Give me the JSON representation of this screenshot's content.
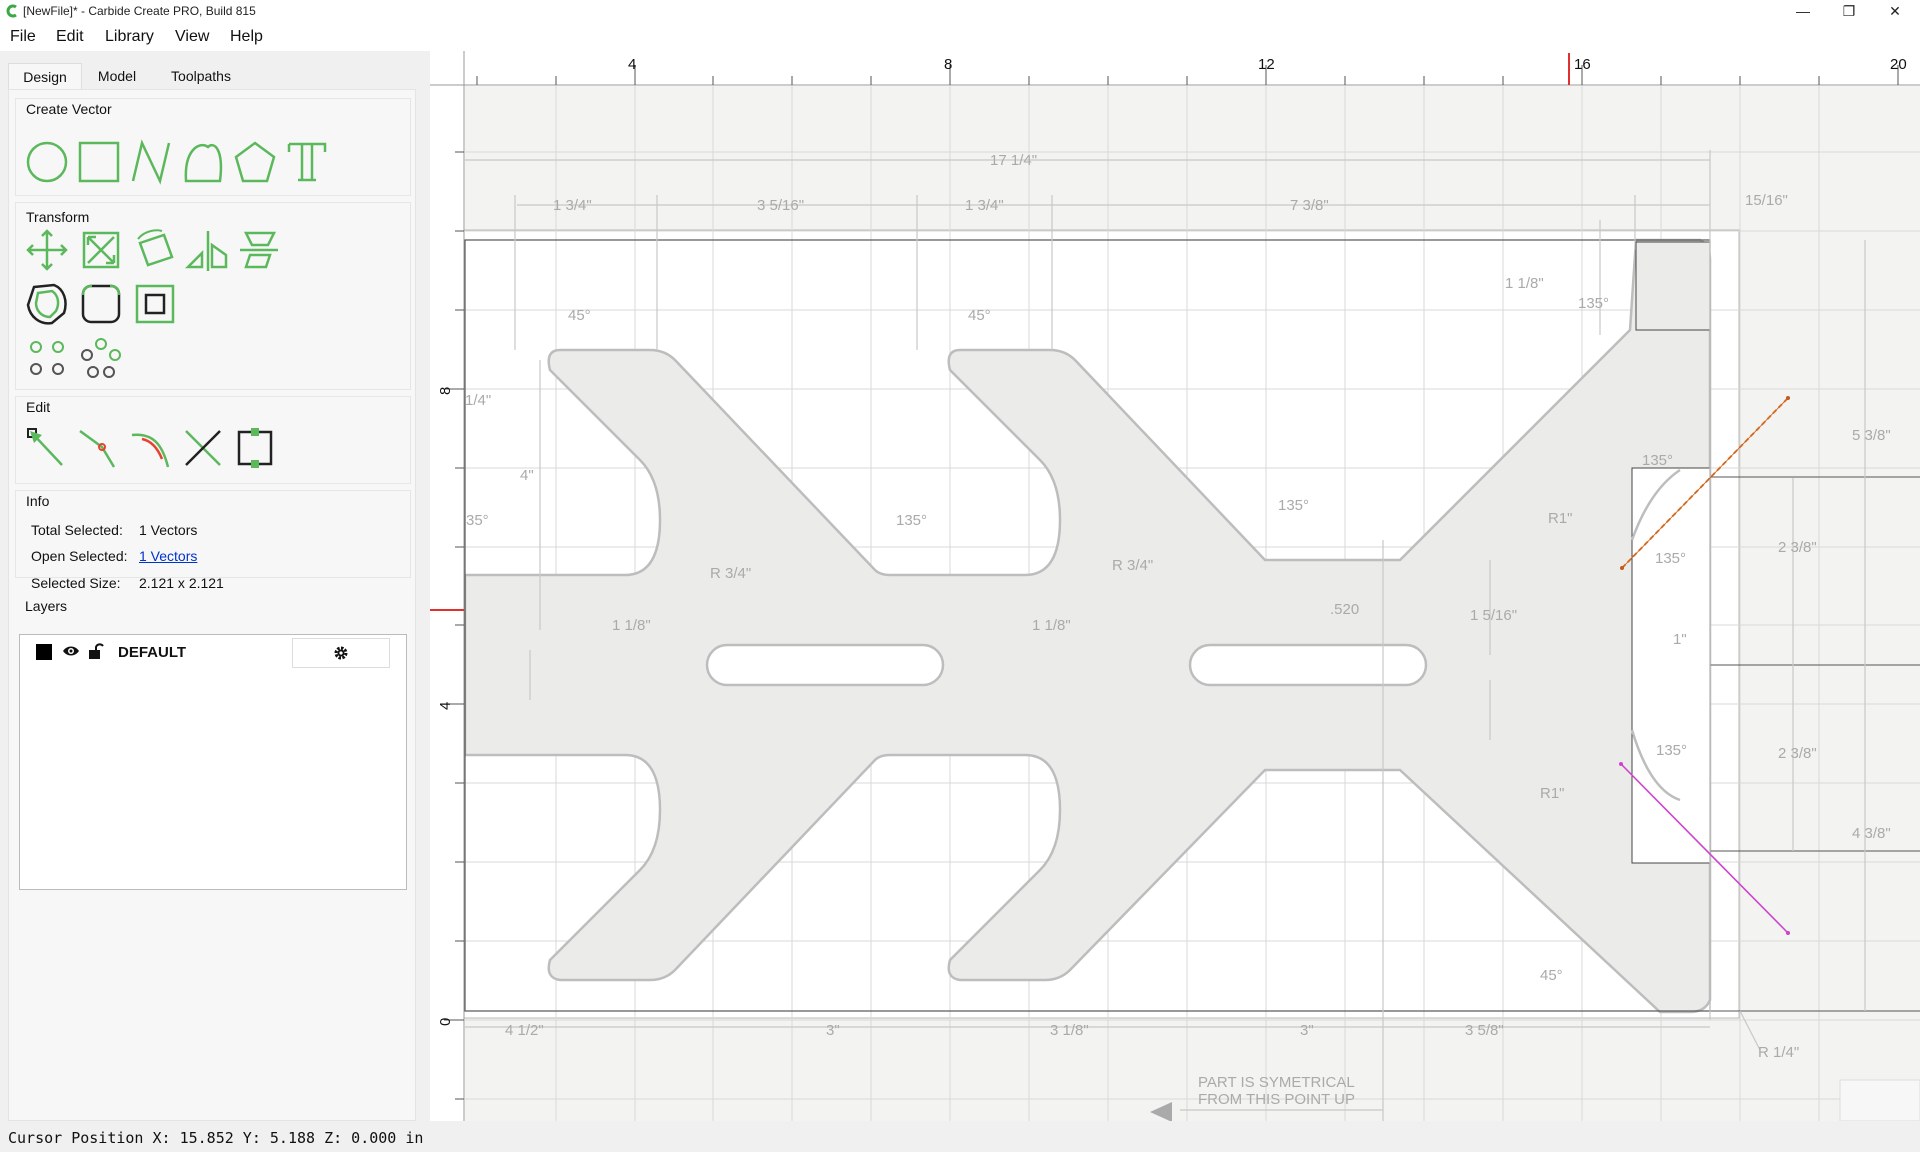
{
  "window": {
    "title": "[NewFile]* - Carbide Create PRO, Build 815",
    "minimize": "—",
    "maximize": "❐",
    "close": "✕"
  },
  "menu": {
    "file": "File",
    "edit": "Edit",
    "library": "Library",
    "view": "View",
    "help": "Help"
  },
  "tabs": {
    "design": "Design",
    "model": "Model",
    "toolpaths": "Toolpaths"
  },
  "sections": {
    "create_vector": "Create Vector",
    "transform": "Transform",
    "edit": "Edit",
    "info": "Info",
    "layers": "Layers"
  },
  "info": {
    "total_selected_label": "Total Selected:",
    "total_selected_value": "1 Vectors",
    "open_selected_label": "Open Selected:",
    "open_selected_value": "1 Vectors",
    "selected_size_label": "Selected Size:",
    "selected_size_value": "2.121 x 2.121"
  },
  "layers": [
    {
      "name": "DEFAULT",
      "color": "#000000"
    }
  ],
  "status": {
    "cursor_position": "Cursor Position X: 15.852 Y: 5.188 Z: 0.000 in"
  },
  "colors": {
    "tool_green": "#5cb85c",
    "edit_red": "#e8432e",
    "ruler_marker": "#e03030"
  },
  "ruler": {
    "h_labels": [
      "4",
      "8",
      "12",
      "16",
      "20"
    ],
    "v_labels": [
      "8",
      "4",
      "0"
    ]
  },
  "drawing": {
    "overall": "17 1/4\"",
    "dim_1_3_4": "1 3/4\"",
    "dim_3_5_16": "3 5/16\"",
    "dim_7_3_8": "7 3/8\"",
    "dim_15_16": "15/16\"",
    "dim_1_1_8": "1 1/8\"",
    "dim_1_5_16": "1 5/16\"",
    "dim_5_3_8": "5 3/8\"",
    "dim_2_3_8": "2 3/8\"",
    "dim_4_3_8": "4 3/8\"",
    "dim_3": "3\"",
    "dim_3_1_8": "3 1/8\"",
    "dim_3_5_8": "3 5/8\"",
    "dim_4_1_2": "4 1/2\"",
    "dim_1_4": "1/4\"",
    "dim_4": "4\"",
    "dim_1": "1\"",
    "dim_520": ".520",
    "r_3_4": "R 3/4\"",
    "r_1_4": "R 1/4\"",
    "r1": "R1\"",
    "a45": "45°",
    "a135": "135°",
    "a35": "35°",
    "note_line1": "PART IS SYMETRICAL",
    "note_line2": "FROM THIS POINT UP"
  }
}
